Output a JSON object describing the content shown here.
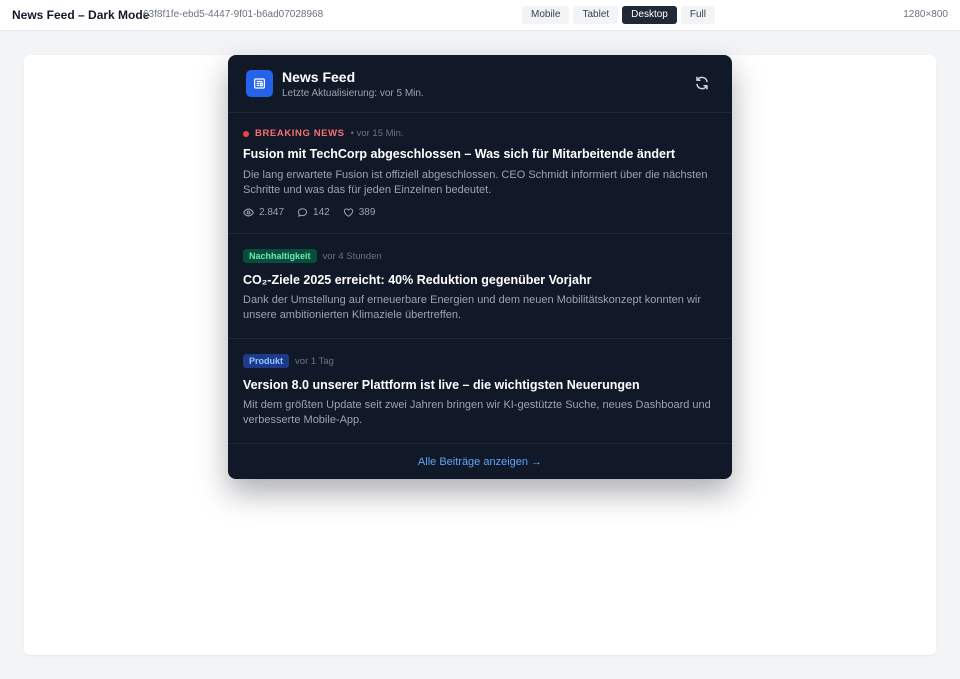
{
  "toolbar": {
    "title": "News Feed – Dark Mode",
    "id": "63f8f1fe-ebd5-4447-9f01-b6ad07028968",
    "viewports": [
      {
        "label": "Mobile",
        "active": false
      },
      {
        "label": "Tablet",
        "active": false
      },
      {
        "label": "Desktop",
        "active": true
      },
      {
        "label": "Full",
        "active": false
      }
    ],
    "resolution": "1280×800"
  },
  "widget": {
    "title": "News Feed",
    "subtitle": "Letzte Aktualisierung: vor 5 Min.",
    "logo_icon": "newspaper-icon",
    "refresh_icon": "refresh-icon",
    "items": [
      {
        "tag": "BREAKING NEWS",
        "tag_style": "breaking",
        "time": "• vor 15 Min.",
        "headline": "Fusion mit TechCorp abgeschlossen – Was sich für Mitarbeitende ändert",
        "description": "Die lang erwartete Fusion ist offiziell abgeschlossen. CEO Schmidt informiert über die nächsten Schritte und was das für jeden Einzelnen bedeutet.",
        "stats": {
          "views": "2.847",
          "comments": "142",
          "likes": "389"
        }
      },
      {
        "tag": "Nachhaltigkeit",
        "tag_style": "green",
        "time": "vor 4 Stunden",
        "headline": "CO₂-Ziele 2025 erreicht: 40% Reduktion gegenüber Vorjahr",
        "description": "Dank der Umstellung auf erneuerbare Energien und dem neuen Mobilitätskonzept konnten wir unsere ambitionierten Klimaziele übertreffen."
      },
      {
        "tag": "Produkt",
        "tag_style": "blue",
        "time": "vor 1 Tag",
        "headline": "Version 8.0 unserer Plattform ist live – die wichtigsten Neuerungen",
        "description": "Mit dem größten Update seit zwei Jahren bringen wir KI-gestützte Suche, neues Dashboard und verbesserte Mobile-App."
      }
    ],
    "footer_link": "Alle Beiträge anzeigen →"
  },
  "colors": {
    "widget_bg": "#111827",
    "accent": "#2563eb",
    "link": "#60a5fa",
    "breaking": "#ef4444",
    "green_badge": "#6ee7b7",
    "blue_badge": "#93c5fd"
  }
}
